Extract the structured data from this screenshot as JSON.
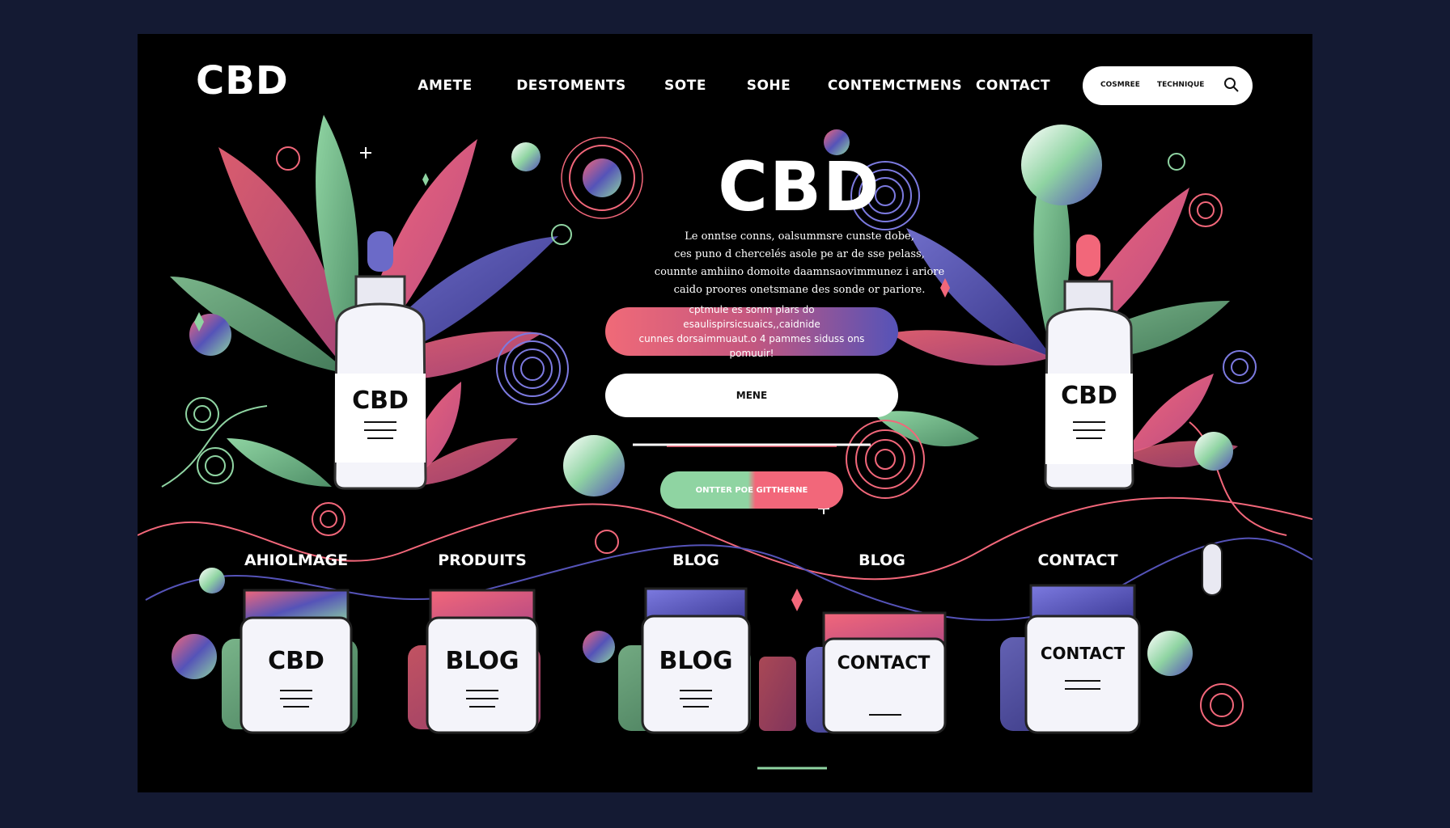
{
  "brand": {
    "logo": "CBD"
  },
  "nav": {
    "items": [
      "AMETE",
      "DESTOMENTS",
      "SOTE",
      "SOHE",
      "CONTEMCTMENS",
      "CONTACT"
    ]
  },
  "search": {
    "option_1": "COSMREE",
    "option_2": "TECHNIQUE",
    "icon": "search-icon"
  },
  "hero": {
    "title": "CBD",
    "description_lines": [
      "Le onntse conns, oalsummsre cunste dobe,",
      "ces puno d chercelés asole pe ar de sse pelass,",
      "counnte amhiino domoite daamnsaovimmunez i ariore",
      "caido proores onetsmane des sonde or pariore."
    ],
    "promo_lines": [
      "cptmule es sonm plars do esaulispirsicsuaics,,caidnide",
      "cunnes dorsaimmuaut.o 4 pammes siduss ons pomuuir!"
    ],
    "menu_button": "MENE",
    "cta_button": "ONTTER POE GITTHERNE"
  },
  "bottles": {
    "left_label": "CBD",
    "right_label": "CBD"
  },
  "sections": [
    {
      "label": "AHIOLMAGE",
      "jar_label": "CBD"
    },
    {
      "label": "PRODUITS",
      "jar_label": "BLOG"
    },
    {
      "label": "BLOG",
      "jar_label": "BLOG"
    },
    {
      "label": "BLOG",
      "jar_label": "CONTACT"
    },
    {
      "label": "CONTACT",
      "jar_label": "CONTACT"
    }
  ],
  "colors": {
    "background": "#000000",
    "outer": "#141a33",
    "coral": "#f2677a",
    "mint": "#8fd4a2",
    "indigo": "#5553b8"
  }
}
